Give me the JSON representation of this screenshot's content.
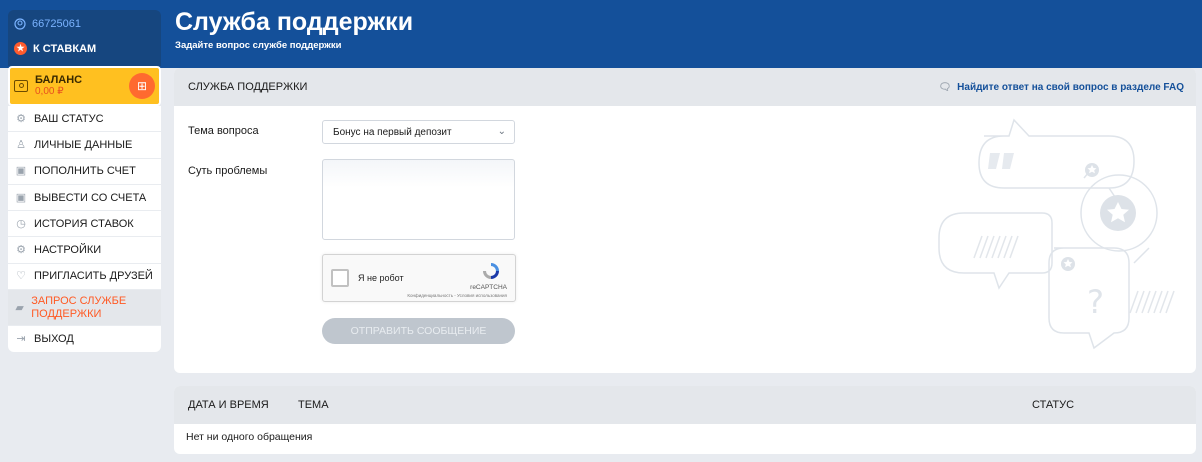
{
  "sidebar": {
    "account_id": "66725061",
    "to_stakes_label": "К СТАВКАМ",
    "balance": {
      "label": "БАЛАНС",
      "value": "0,00 ₽"
    },
    "items": [
      {
        "label": "ВАШ СТАТУС",
        "icon": "status-icon"
      },
      {
        "label": "ЛИЧНЫЕ ДАННЫЕ",
        "icon": "user-icon"
      },
      {
        "label": "ПОПОЛНИТЬ СЧЕТ",
        "icon": "deposit-icon"
      },
      {
        "label": "ВЫВЕСТИ СО СЧЕТА",
        "icon": "withdraw-icon"
      },
      {
        "label": "ИСТОРИЯ СТАВОК",
        "icon": "history-icon"
      },
      {
        "label": "НАСТРОЙКИ",
        "icon": "settings-icon"
      },
      {
        "label": "ПРИГЛАСИТЬ ДРУЗЕЙ",
        "icon": "invite-icon"
      },
      {
        "label": "ЗАПРОС СЛУЖБЕ ПОДДЕРЖКИ",
        "icon": "support-icon",
        "active": true
      },
      {
        "label": "ВЫХОД",
        "icon": "logout-icon"
      }
    ]
  },
  "page": {
    "title": "Служба поддержки",
    "subtitle": "Задайте вопрос службе поддержки"
  },
  "form_card": {
    "title": "СЛУЖБА ПОДДЕРЖКИ",
    "faq_link": "Найдите ответ на свой вопрос в разделе FAQ",
    "topic_label": "Тема вопроса",
    "topic_value": "Бонус на первый депозит",
    "problem_label": "Суть проблемы",
    "problem_value": "",
    "captcha": {
      "text": "Я не робот",
      "brand": "reCAPTCHA",
      "terms": "Конфиденциальность - Условия использования"
    },
    "submit_label": "ОТПРАВИТЬ СООБЩЕНИЕ"
  },
  "requests_table": {
    "columns": {
      "date": "ДАТА И ВРЕМЯ",
      "topic": "ТЕМА",
      "status": "СТАТУС"
    },
    "empty_text": "Нет ни одного обращения"
  },
  "colors": {
    "header_blue": "#14509a",
    "accent_orange": "#ff5a24",
    "balance_yellow": "#ffc020"
  }
}
